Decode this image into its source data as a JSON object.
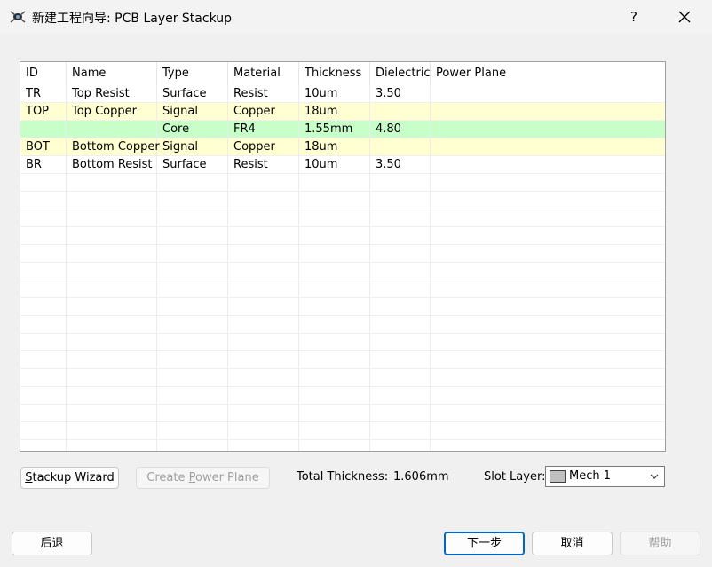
{
  "window": {
    "title": "新建工程向导: PCB Layer Stackup",
    "help": "?",
    "icons": {
      "app": "pcb-app-icon",
      "close": "close-icon"
    }
  },
  "table": {
    "headers": [
      "ID",
      "Name",
      "Type",
      "Material",
      "Thickness",
      "Dielectric",
      "Power Plane"
    ],
    "rows": [
      [
        "TR",
        "Top Resist",
        "Surface",
        "Resist",
        "10um",
        "3.50",
        ""
      ],
      [
        "TOP",
        "Top Copper",
        "Signal",
        "Copper",
        "18um",
        "",
        ""
      ],
      [
        "",
        "",
        "Core",
        "FR4",
        "1.55mm",
        "4.80",
        ""
      ],
      [
        "BOT",
        "Bottom Copper",
        "Signal",
        "Copper",
        "18um",
        "",
        ""
      ],
      [
        "BR",
        "Bottom Resist",
        "Surface",
        "Resist",
        "10um",
        "3.50",
        ""
      ]
    ],
    "row_colors": [
      "#ffffff",
      "#ffffd2",
      "#c8ffc8",
      "#ffffd2",
      "#ffffff"
    ]
  },
  "controls": {
    "stackup_wizard_prefix": "",
    "stackup_wizard_mnemonic": "S",
    "stackup_wizard_rest": "tackup Wizard",
    "create_power_plane_prefix": "Create ",
    "create_power_plane_mnemonic": "P",
    "create_power_plane_rest": "ower Plane",
    "total_thickness_label": "Total Thickness:",
    "total_thickness_value": "1.606mm",
    "slot_layer_label": "Slot Layer:",
    "slot_layer_value": "Mech 1",
    "slot_layer_swatch": "#c0c0c0"
  },
  "footer": {
    "back": "后退",
    "next": "下一步",
    "cancel": "取消",
    "help": "帮助"
  }
}
